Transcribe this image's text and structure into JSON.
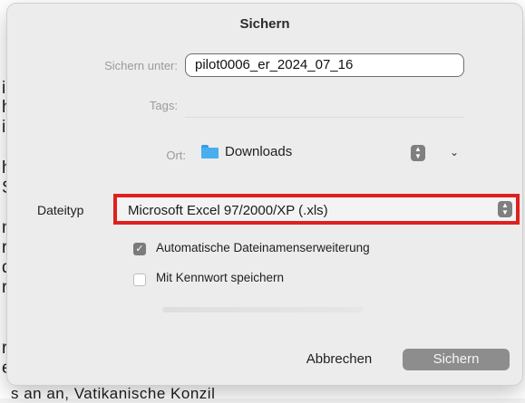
{
  "dialog": {
    "title": "Sichern",
    "save_as_label": "Sichern unter:",
    "save_as_value": "pilot0006_er_2024_07_16",
    "tags_label": "Tags:",
    "location_label": "Ort:",
    "location_value": "Downloads",
    "file_type_label": "Dateityp",
    "file_type_value": "Microsoft Excel 97/2000/XP (.xls)",
    "option_auto_extension": "Automatische Dateinamenserweiterung",
    "option_auto_extension_checked": true,
    "option_password": "Mit Kennwort speichern",
    "option_password_checked": false,
    "cancel_button": "Abbrechen",
    "save_button": "Sichern"
  },
  "background_document": {
    "left_letters": [
      "i",
      "h",
      "i",
      "h",
      "S",
      "n",
      "r",
      "d",
      "r",
      "r",
      "e"
    ],
    "bottom_text": "s an an, Vatikanische Konzil"
  },
  "icons": {
    "location": "folder-icon",
    "location_stepper": "stepper-icon",
    "location_expand": "chevron-down-icon",
    "type_stepper": "stepper-icon",
    "checkbox_checked": "checkmark-icon"
  },
  "colors": {
    "highlight_border": "#e02020",
    "folder": "#48aef0",
    "default_button": "#8d8d8d"
  }
}
